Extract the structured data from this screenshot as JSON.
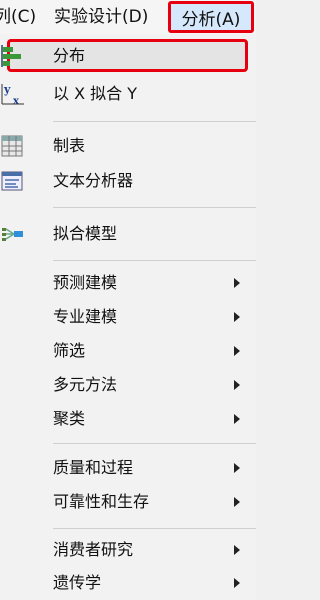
{
  "menubar": {
    "items": [
      "列(C)",
      "实验设计(D)",
      "分析(A)"
    ],
    "active": "分析(A)"
  },
  "menu": {
    "items": [
      {
        "label": "分布",
        "icon": "distribution-icon",
        "submenu": false,
        "highlighted": true
      },
      {
        "label": "以 X 拟合 Y",
        "icon": "fit-y-by-x-icon",
        "submenu": false
      },
      {
        "label": "制表",
        "icon": "tabulate-icon",
        "submenu": false
      },
      {
        "label": "文本分析器",
        "icon": "text-explorer-icon",
        "submenu": false
      },
      {
        "label": "拟合模型",
        "icon": "fit-model-icon",
        "submenu": false
      },
      {
        "label": "预测建模",
        "submenu": true
      },
      {
        "label": "专业建模",
        "submenu": true
      },
      {
        "label": "筛选",
        "submenu": true
      },
      {
        "label": "多元方法",
        "submenu": true
      },
      {
        "label": "聚类",
        "submenu": true
      },
      {
        "label": "质量和过程",
        "submenu": true
      },
      {
        "label": "可靠性和生存",
        "submenu": true
      },
      {
        "label": "消费者研究",
        "submenu": true
      },
      {
        "label": "遗传学",
        "submenu": true
      }
    ]
  },
  "colors": {
    "highlight_border": "#e6000f",
    "active_menu_bg": "#d6e8fb"
  }
}
